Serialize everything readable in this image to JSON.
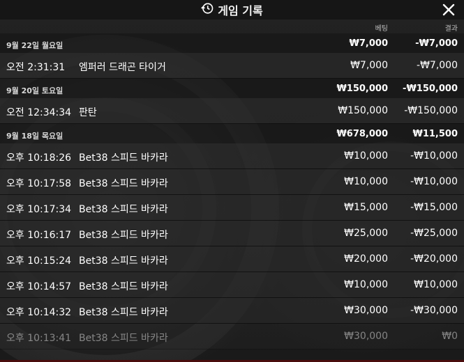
{
  "header": {
    "title": "게임 기록",
    "history_icon": "history-icon",
    "close_icon": "close-icon"
  },
  "columns": {
    "bet": "베팅",
    "result": "결과"
  },
  "groups": [
    {
      "date": "9월 22일 월요일",
      "bet_total": "₩7,000",
      "result_total": "-₩7,000",
      "rows": [
        {
          "time": "오전 2:31:31",
          "game": "엠퍼러 드래곤 타이거",
          "bet": "₩7,000",
          "result": "-₩7,000"
        }
      ]
    },
    {
      "date": "9월 20일 토요일",
      "bet_total": "₩150,000",
      "result_total": "-₩150,000",
      "rows": [
        {
          "time": "오전 12:34:34",
          "game": "판탄",
          "bet": "₩150,000",
          "result": "-₩150,000"
        }
      ]
    },
    {
      "date": "9월 18일 목요일",
      "bet_total": "₩678,000",
      "result_total": "₩11,500",
      "rows": [
        {
          "time": "오후 10:18:26",
          "game": "Bet38 스피드 바카라",
          "bet": "₩10,000",
          "result": "-₩10,000"
        },
        {
          "time": "오후 10:17:58",
          "game": "Bet38 스피드 바카라",
          "bet": "₩10,000",
          "result": "-₩10,000"
        },
        {
          "time": "오후 10:17:34",
          "game": "Bet38 스피드 바카라",
          "bet": "₩15,000",
          "result": "-₩15,000"
        },
        {
          "time": "오후 10:16:17",
          "game": "Bet38 스피드 바카라",
          "bet": "₩25,000",
          "result": "-₩25,000"
        },
        {
          "time": "오후 10:15:24",
          "game": "Bet38 스피드 바카라",
          "bet": "₩20,000",
          "result": "-₩20,000"
        },
        {
          "time": "오후 10:14:57",
          "game": "Bet38 스피드 바카라",
          "bet": "₩10,000",
          "result": "₩10,000"
        },
        {
          "time": "오후 10:14:32",
          "game": "Bet38 스피드 바카라",
          "bet": "₩30,000",
          "result": "-₩30,000"
        },
        {
          "time": "오후 10:13:41",
          "game": "Bet38 스피드 바카라",
          "bet": "₩30,000",
          "result": "₩0"
        }
      ]
    }
  ]
}
